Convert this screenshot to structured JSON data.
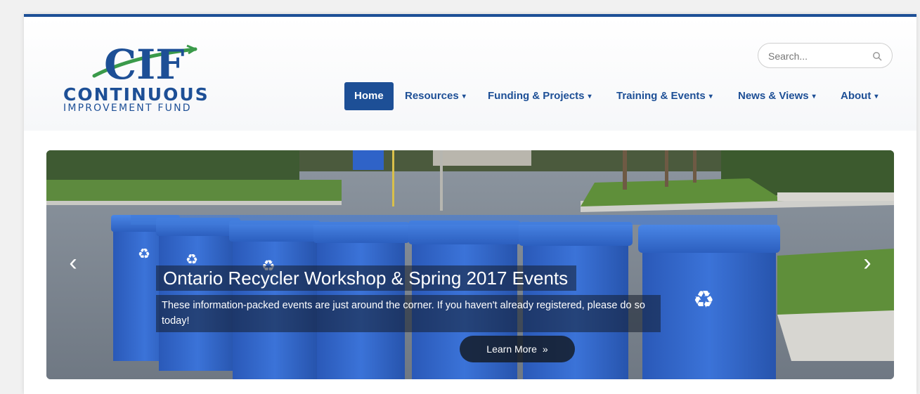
{
  "logo": {
    "mark": "CIF",
    "line1": "CONTINUOUS",
    "line2": "IMPROVEMENT FUND"
  },
  "search": {
    "placeholder": "Search...",
    "icon": "search-icon"
  },
  "nav": {
    "items": [
      {
        "label": "Home",
        "dropdown": false,
        "active": true
      },
      {
        "label": "Resources",
        "dropdown": true
      },
      {
        "label": "Funding & Projects",
        "dropdown": true
      },
      {
        "label": "Training & Events",
        "dropdown": true
      },
      {
        "label": "News & Views",
        "dropdown": true
      },
      {
        "label": "About",
        "dropdown": true
      }
    ],
    "caret": "▾"
  },
  "slider": {
    "title": "Ontario Recycler Workshop & Spring 2017 Events",
    "text": "These information-packed events are just around the corner. If you haven't already registered, please do so today!",
    "button_label": "Learn More",
    "button_icon": "»",
    "prev_icon": "‹",
    "next_icon": "›"
  },
  "colors": {
    "brand_blue": "#1d4f96",
    "logo_green": "#3a9a4a",
    "bin_blue": "#2f63c8"
  }
}
